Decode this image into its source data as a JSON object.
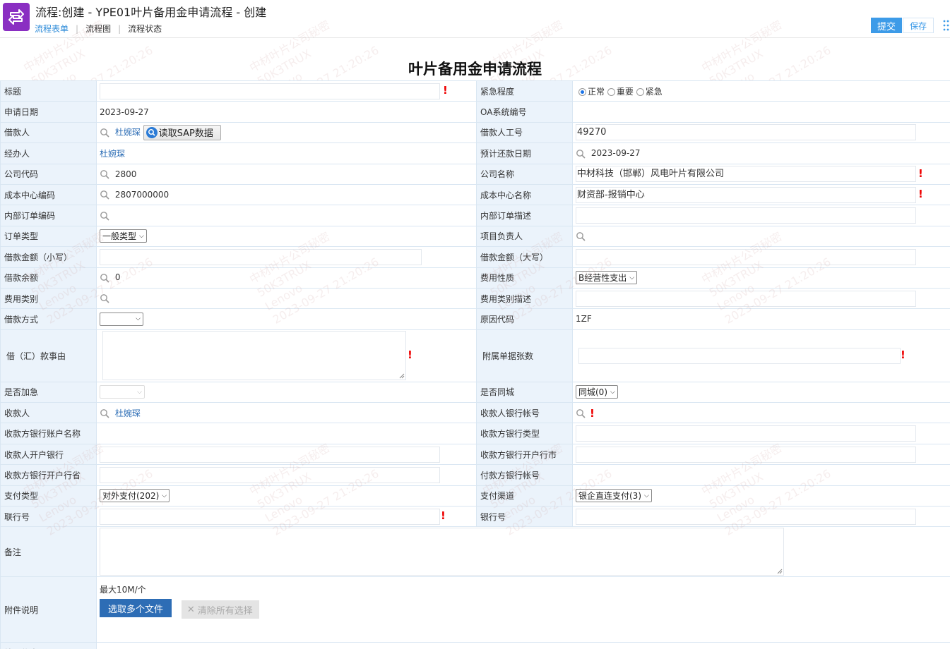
{
  "window": {
    "title": "流程:创建 - YPE01叶片备用金申请流程 - 创建"
  },
  "tabs": [
    {
      "label": "流程表单"
    },
    {
      "label": "流程图"
    },
    {
      "label": "流程状态"
    }
  ],
  "toolbar": {
    "submit_label": "提交",
    "save_label": "保存"
  },
  "form": {
    "title": "叶片备用金申请流程",
    "labels": {
      "title": "标题",
      "urgency": "紧急程度",
      "apply_date": "申请日期",
      "oa_no": "OA系统编号",
      "borrower": "借款人",
      "borrower_no": "借款人工号",
      "handler": "经办人",
      "repay_date": "预计还款日期",
      "company_code": "公司代码",
      "company_name": "公司名称",
      "cost_center_code": "成本中心编码",
      "cost_center_name": "成本中心名称",
      "internal_order_code": "内部订单编码",
      "internal_order_desc": "内部订单描述",
      "order_type": "订单类型",
      "project_lead": "项目负责人",
      "amount_small": "借款金额（小写）",
      "amount_big": "借款金额（大写）",
      "balance": "借款余额",
      "expense_nature": "费用性质",
      "expense_category": "费用类别",
      "expense_category_desc": "费用类别描述",
      "loan_method": "借款方式",
      "reason_code": "原因代码",
      "reason": "借（汇）款事由",
      "attachment_count": "附属单据张数",
      "is_urgent": "是否加急",
      "same_city": "是否同城",
      "payee": "收款人",
      "payee_account": "收款人银行帐号",
      "payee_account_name": "收款方银行账户名称",
      "payee_bank_type": "收款方银行类型",
      "payee_bank": "收款人开户银行",
      "payee_bank_city": "收款方银行开户行市",
      "payee_bank_province": "收款方银行开户行省",
      "payer_account": "付款方银行帐号",
      "payment_type": "支付类型",
      "payment_channel": "支付渠道",
      "bank_code": "联行号",
      "bank_no": "银行号",
      "remark": "备注",
      "attachment_desc": "附件说明",
      "process_info": "处理信息"
    },
    "values": {
      "urgency_options": [
        "正常",
        "重要",
        "紧急"
      ],
      "urgency_selected": "正常",
      "apply_date": "2023-09-27",
      "borrower": "杜婉琛",
      "sap_button": "读取SAP数据",
      "borrower_no": "49270",
      "handler": "杜婉琛",
      "repay_date": "2023-09-27",
      "company_code": "2800",
      "company_name": "中材科技（邯郸）风电叶片有限公司",
      "cost_center_code": "2807000000",
      "cost_center_name": "财资部-报销中心",
      "order_type": "一般类型",
      "balance": "0",
      "expense_nature": "B经营性支出",
      "reason_code": "1ZF",
      "same_city": "同城(0)",
      "payee": "杜婉琛",
      "payment_type": "对外支付(202)",
      "payment_channel": "银企直连支付(3)",
      "attachment_limit": "最大10M/个",
      "select_files": "选取多个文件",
      "clear_selection": "清除所有选择"
    }
  },
  "watermark": {
    "line1": "中材叶片公司秘密",
    "line2": "50K3TRUX",
    "line3": "Lenovo",
    "line4": "2023-09-27 21:20:26"
  },
  "colors": {
    "label_bg": "#ebf3fb",
    "accent": "#3d9be8",
    "logo": "#8a2fc2",
    "required": "#e00000",
    "file_button": "#2d6db5"
  }
}
